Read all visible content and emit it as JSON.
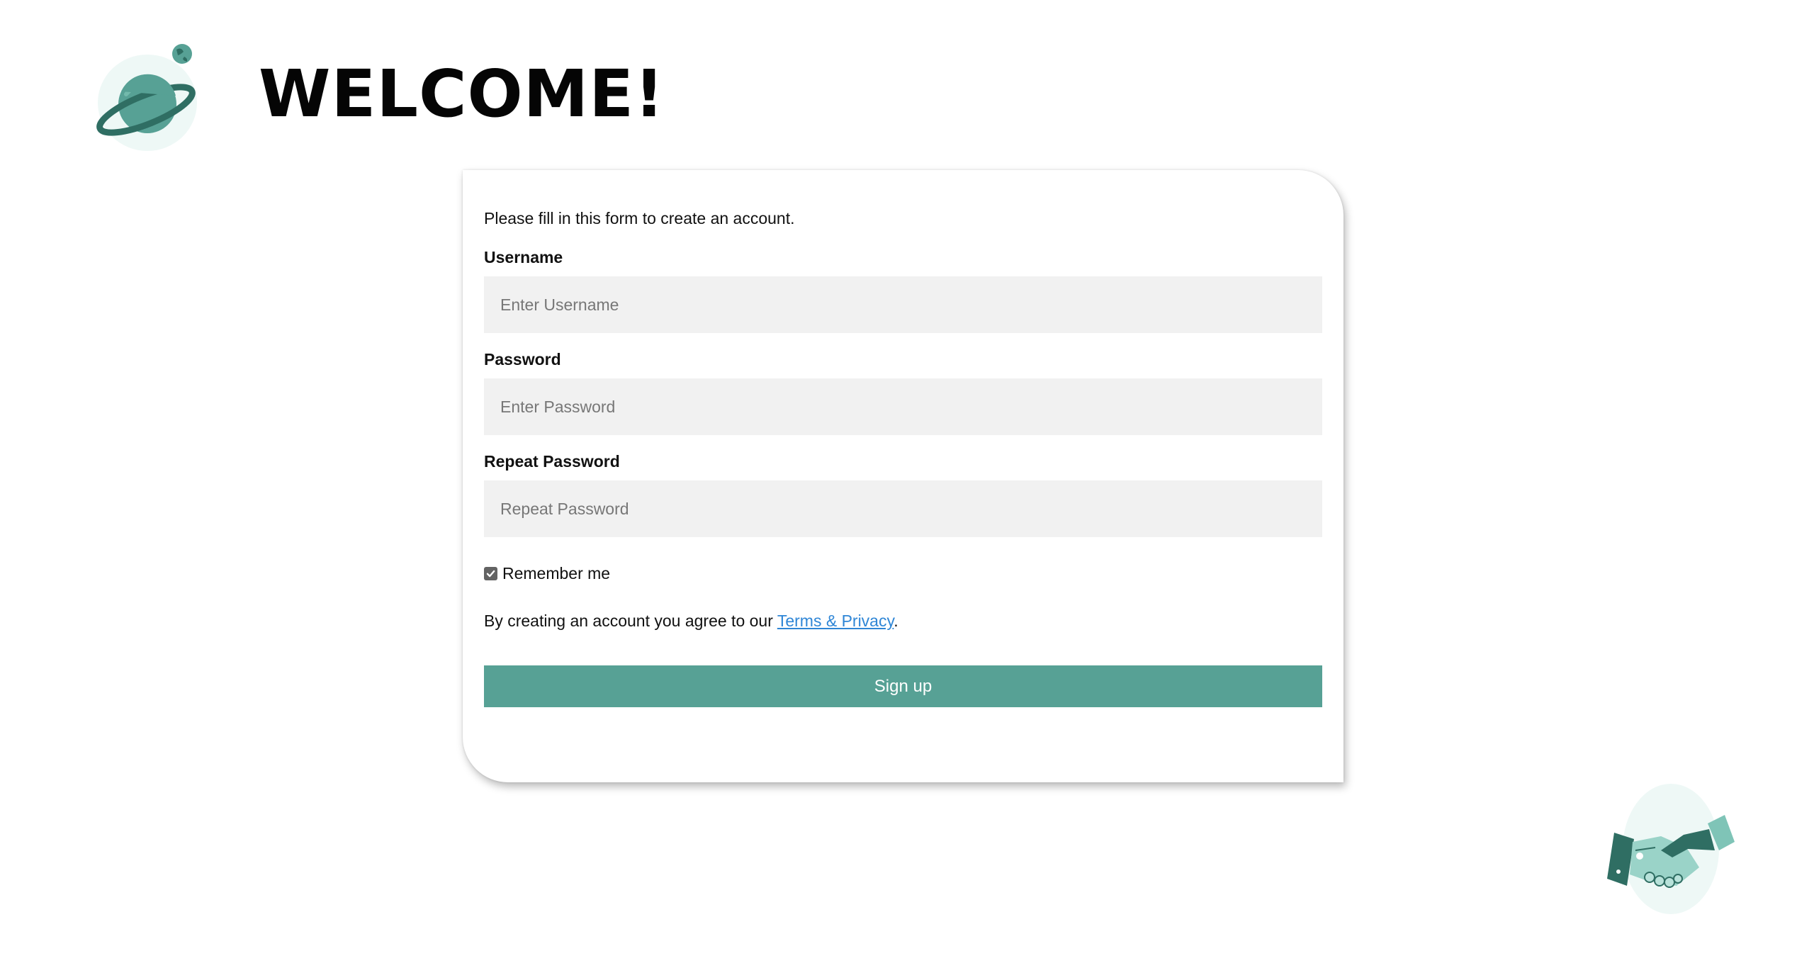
{
  "header": {
    "title": "WELCOME!",
    "logo_icon": "planet-icon"
  },
  "form": {
    "intro": "Please fill in this form to create an account.",
    "username": {
      "label": "Username",
      "placeholder": "Enter Username",
      "value": ""
    },
    "password": {
      "label": "Password",
      "placeholder": "Enter Password",
      "value": ""
    },
    "repeat_password": {
      "label": "Repeat Password",
      "placeholder": "Repeat Password",
      "value": ""
    },
    "remember": {
      "label": "Remember me",
      "checked": true
    },
    "terms": {
      "prefix": "By creating an account you agree to our ",
      "link_text": "Terms & Privacy",
      "suffix": "."
    },
    "submit_label": "Sign up"
  },
  "decor": {
    "footer_icon": "handshake-icon"
  },
  "colors": {
    "accent": "#57a195",
    "accent_dark": "#2f6e63",
    "accent_light": "#7fc4b7",
    "input_bg": "#f1f1f1",
    "link": "#2f86d6"
  }
}
